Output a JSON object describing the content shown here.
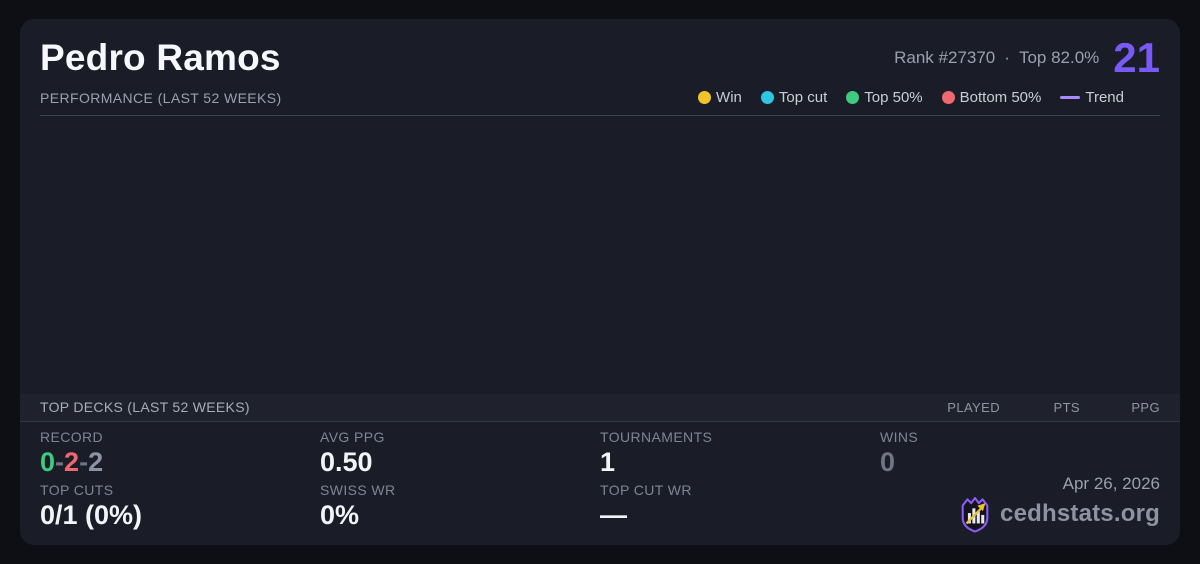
{
  "card": {
    "player_name": "Pedro Ramos",
    "rank_text": "Rank #27370",
    "dot_separator": "·",
    "top_percent_text": "Top 82.0%",
    "score": "21",
    "accent_color": "#7a5af5",
    "card_bg": "#1a1d27",
    "page_bg": "#0e0f14"
  },
  "performance": {
    "section_title": "PERFORMANCE (LAST 52 WEEKS)",
    "legend": [
      {
        "label": "Win",
        "color": "#f0c429",
        "marker": "dot"
      },
      {
        "label": "Top cut",
        "color": "#2fc6e2",
        "marker": "dot"
      },
      {
        "label": "Top 50%",
        "color": "#3ecb7e",
        "marker": "dot"
      },
      {
        "label": "Bottom 50%",
        "color": "#ef676f",
        "marker": "dot"
      },
      {
        "label": "Trend",
        "color": "#a78bfa",
        "marker": "line"
      }
    ]
  },
  "chart_data": {
    "type": "scatter",
    "series": [
      {
        "name": "Win",
        "points": []
      },
      {
        "name": "Top cut",
        "points": []
      },
      {
        "name": "Top 50%",
        "points": []
      },
      {
        "name": "Bottom 50%",
        "points": []
      }
    ],
    "note": "chart plot area is rendered empty — no data points visible"
  },
  "top_decks": {
    "section_title": "TOP DECKS (LAST 52 WEEKS)",
    "columns": [
      "PLAYED",
      "PTS",
      "PPG"
    ],
    "rows": []
  },
  "stats": {
    "record": {
      "label": "RECORD",
      "wins": "0",
      "losses": "2",
      "draws": "2",
      "separator": "-",
      "win_color": "#3ecb7e",
      "loss_color": "#ef676f",
      "draw_color": "#8c94a3"
    },
    "avg_ppg": {
      "label": "AVG PPG",
      "value": "0.50"
    },
    "tournaments": {
      "label": "TOURNAMENTS",
      "value": "1"
    },
    "wins": {
      "label": "WINS",
      "value": "0"
    },
    "top_cuts": {
      "label": "TOP CUTS",
      "value": "0/1 (0%)"
    },
    "swiss_wr": {
      "label": "SWISS WR",
      "value": "0%"
    },
    "top_cut_wr": {
      "label": "TOP CUT WR",
      "value": "—"
    }
  },
  "footer": {
    "date": "Apr 26, 2026",
    "brand": "cedhstats.org",
    "logo": "shield-barchart-arrow-icon"
  }
}
